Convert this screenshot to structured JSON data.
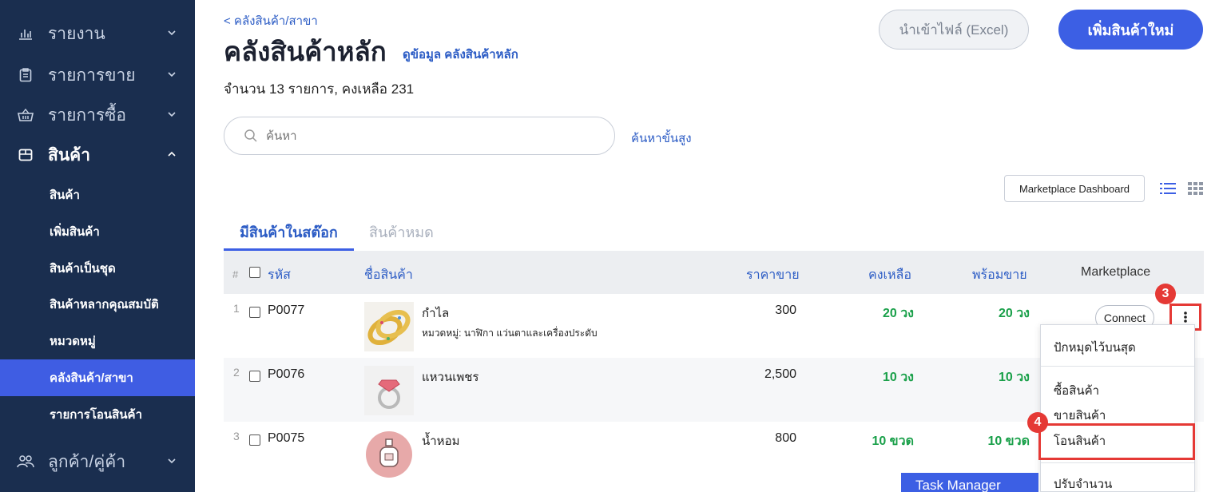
{
  "sidebar": {
    "groups": [
      {
        "label": "รายงาน",
        "icon": "chart-icon"
      },
      {
        "label": "รายการขาย",
        "icon": "clipboard-icon"
      },
      {
        "label": "รายการซื้อ",
        "icon": "basket-icon"
      },
      {
        "label": "สินค้า",
        "icon": "box-icon"
      },
      {
        "label": "ลูกค้า/คู่ค้า",
        "icon": "people-icon"
      }
    ],
    "sub_items": [
      {
        "label": "สินค้า"
      },
      {
        "label": "เพิ่มสินค้า"
      },
      {
        "label": "สินค้าเป็นชุด"
      },
      {
        "label": "สินค้าหลากคุณสมบัติ"
      },
      {
        "label": "หมวดหมู่"
      },
      {
        "label": "คลังสินค้า/สาขา"
      },
      {
        "label": "รายการโอนสินค้า"
      }
    ]
  },
  "header": {
    "breadcrumb": "< คลังสินค้า/สาขา",
    "title": "คลังสินค้าหลัก",
    "title_link": "ดูข้อมูล คลังสินค้าหลัก",
    "summary": "จำนวน 13 รายการ, คงเหลือ 231",
    "import_button": "นำเข้าไฟล์ (Excel)",
    "add_button": "เพิ่มสินค้าใหม่"
  },
  "search": {
    "placeholder": "ค้นหา",
    "advanced": "ค้นหาขั้นสูง"
  },
  "toolbar": {
    "marketplace_dashboard": "Marketplace Dashboard"
  },
  "tabs": [
    {
      "label": "มีสินค้าในสต๊อก"
    },
    {
      "label": "สินค้าหมด"
    }
  ],
  "table": {
    "headers": {
      "num": "#",
      "code": "รหัส",
      "name": "ชื่อสินค้า",
      "price": "ราคาขาย",
      "remain": "คงเหลือ",
      "ready": "พร้อมขาย",
      "marketplace": "Marketplace"
    },
    "rows": [
      {
        "num": "1",
        "code": "P0077",
        "name": "กำไล",
        "category": "หมวดหมู่: นาฬิกา แว่นตาและเครื่องประดับ",
        "price": "300",
        "remain": "20 วง",
        "ready": "20 วง"
      },
      {
        "num": "2",
        "code": "P0076",
        "name": "แหวนเพชร",
        "category": "",
        "price": "2,500",
        "remain": "10 วง",
        "ready": "10 วง"
      },
      {
        "num": "3",
        "code": "P0075",
        "name": "น้ำหอม",
        "category": "",
        "price": "800",
        "remain": "10 ขวด",
        "ready": "10 ขวด"
      }
    ],
    "connect_label": "Connect"
  },
  "dropdown": {
    "items": [
      {
        "label": "ปักหมุดไว้บนสุด"
      },
      {
        "label": "ซื้อสินค้า"
      },
      {
        "label": "ขายสินค้า"
      },
      {
        "label": "โอนสินค้า"
      },
      {
        "label": "ปรับจำนวน"
      }
    ]
  },
  "annotations": {
    "badge_kebab": "3",
    "badge_transfer": "4"
  },
  "taskbar": {
    "label": "Task Manager"
  },
  "colors": {
    "sidebar_bg": "#1a2e4f",
    "sidebar_active": "#3f5de3",
    "accent": "#3c5fe4",
    "link": "#2c5cc5",
    "stock_green": "#1aa04a",
    "highlight_red": "#e53935"
  }
}
